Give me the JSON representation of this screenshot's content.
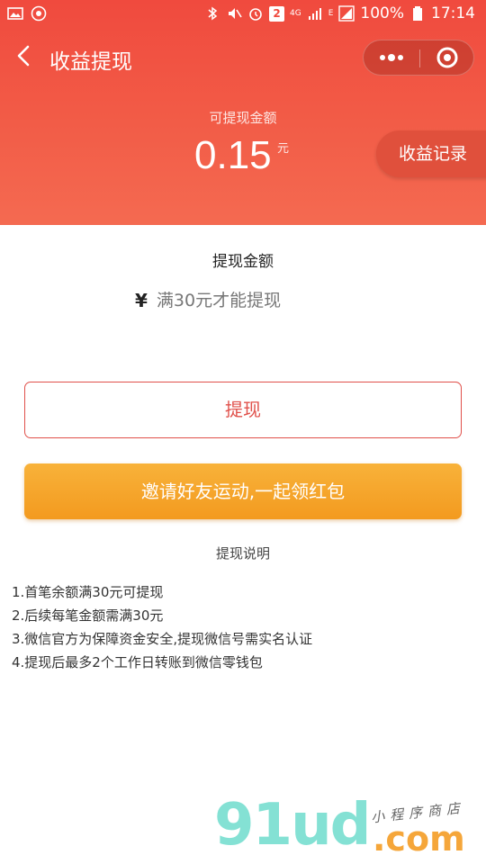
{
  "status_bar": {
    "battery": "100%",
    "time": "17:14",
    "sim_badge": "2",
    "network": "4G",
    "signal_label": "E"
  },
  "nav": {
    "title": "收益提现",
    "back_icon": "chevron-left-icon",
    "more_icon": "more-dots-icon",
    "close_icon": "target-circle-icon"
  },
  "balance": {
    "label": "可提现金额",
    "amount": "0.15",
    "unit": "元",
    "records_button": "收益记录"
  },
  "withdraw": {
    "section_title": "提现金额",
    "currency_symbol": "¥",
    "input_placeholder": "满30元才能提现",
    "submit_button": "提现",
    "invite_button": "邀请好友运动,一起领红包"
  },
  "notes": {
    "title": "提现说明",
    "items": [
      "1.首笔余额满30元可提现",
      "2.后续每笔金额需满30元",
      "3.微信官方为保障资金安全,提现微信号需实名认证",
      "4.提现后最多2个工作日转账到微信零钱包"
    ]
  },
  "watermark": {
    "brand": "91ud",
    "domain": ".com",
    "tagline": "小程序商店"
  },
  "colors": {
    "header_red": "#f04a3e",
    "button_red": "#e0504a",
    "invite_orange": "#f39a1f"
  }
}
